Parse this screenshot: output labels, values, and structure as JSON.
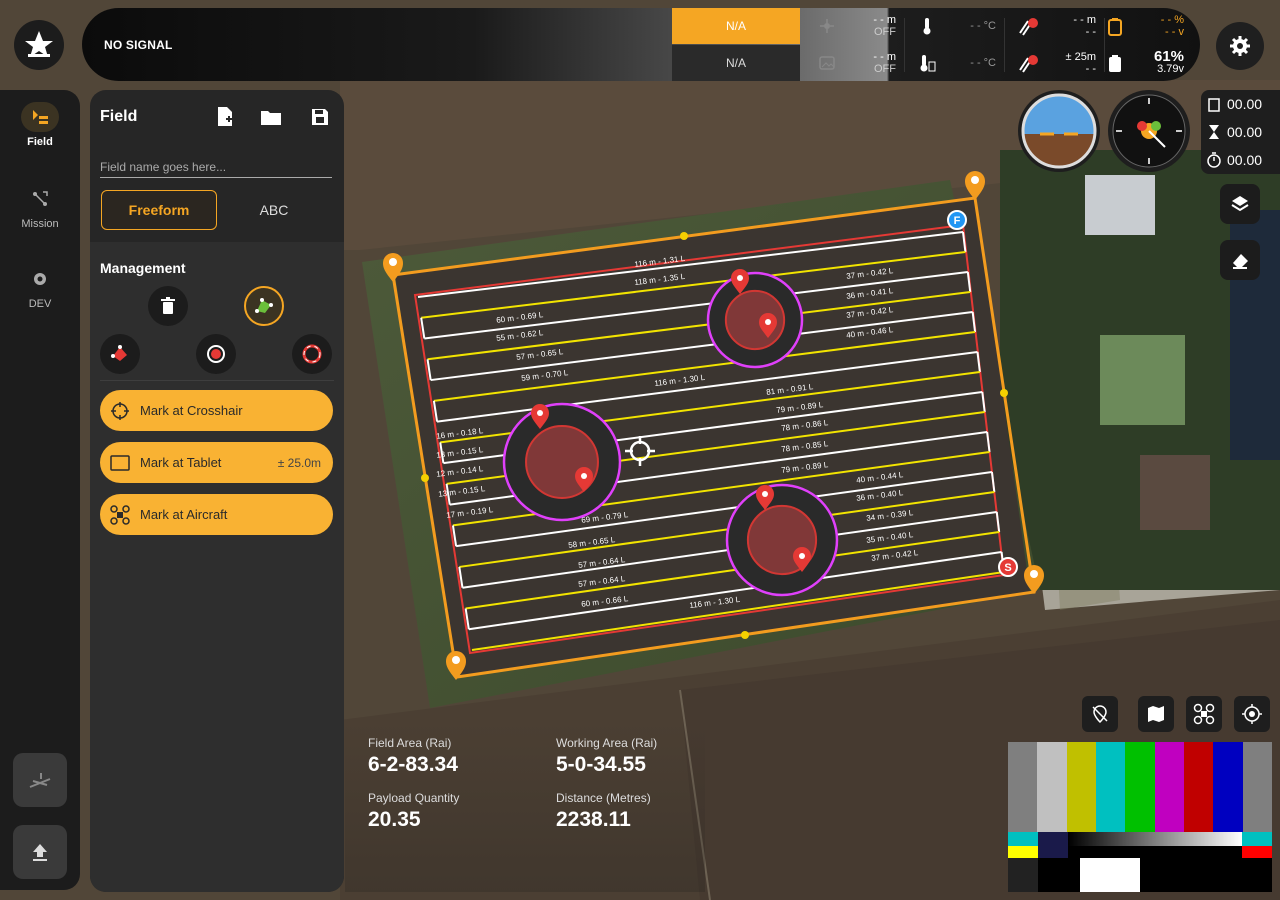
{
  "topbar": {
    "signal": "NO SIGNAL",
    "na_top": "N/A",
    "na_bottom": "N/A",
    "altitude": {
      "value": "- - m",
      "state": "OFF"
    },
    "altitude2": {
      "value": "- - m",
      "state": "OFF"
    },
    "temp1": "- - °C",
    "temp2": "- - °C",
    "rc1": {
      "value": "- - m",
      "sub": "- -"
    },
    "rc2": {
      "value": "± 25m",
      "sub": "- -"
    },
    "battery1": {
      "value": "- - %",
      "sub": "- - v"
    },
    "battery2": {
      "value": "61%",
      "sub": "3.79v"
    },
    "accent": "#f5a623"
  },
  "rail": {
    "items": [
      {
        "label": "Field",
        "icon": "field-icon"
      },
      {
        "label": "Mission",
        "icon": "mission-icon"
      },
      {
        "label": "DEV",
        "icon": "dev-gear-icon"
      }
    ]
  },
  "panel": {
    "title": "Field",
    "name_placeholder": "Field name goes here...",
    "modes": [
      "Freeform",
      "ABC"
    ],
    "management_label": "Management",
    "mark_crosshair": "Mark at Crosshair",
    "mark_tablet": "Mark at Tablet",
    "mark_tablet_accuracy": "± 25.0m",
    "mark_aircraft": "Mark at Aircraft"
  },
  "timers": {
    "a": "00.00",
    "b": "00.00",
    "c": "00.00"
  },
  "stats": {
    "field_area_label": "Field Area (Rai)",
    "field_area": "6-2-83.34",
    "working_area_label": "Working Area (Rai)",
    "working_area": "5-0-34.55",
    "payload_label": "Payload Quantity",
    "payload": "20.35",
    "distance_label": "Distance (Metres)",
    "distance": "2238.11"
  },
  "map": {
    "start_marker": "S",
    "finish_marker": "F",
    "line_labels": [
      "116 m - 1.31 L",
      "118 m - 1.35 L",
      "37 m - 0.42 L",
      "36 m - 0.41 L",
      "37 m - 0.42 L",
      "40 m - 0.46 L",
      "60 m - 0.69 L",
      "55 m - 0.62 L",
      "57 m - 0.65 L",
      "59 m - 0.70 L",
      "116 m - 1.30 L",
      "81 m - 0.91 L",
      "79 m - 0.89 L",
      "78 m - 0.86 L",
      "78 m - 0.85 L",
      "79 m - 0.89 L",
      "40 m - 0.44 L",
      "36 m - 0.40 L",
      "34 m - 0.39 L",
      "35 m - 0.40 L",
      "37 m - 0.42 L",
      "16 m - 0.18 L",
      "13 m - 0.15 L",
      "12 m - 0.14 L",
      "13 m - 0.15 L",
      "17 m - 0.19 L",
      "69 m - 0.79 L",
      "58 m - 0.65 L",
      "57 m - 0.64 L",
      "57 m - 0.64 L",
      "60 m - 0.66 L",
      "116 m - 1.30 L"
    ]
  }
}
